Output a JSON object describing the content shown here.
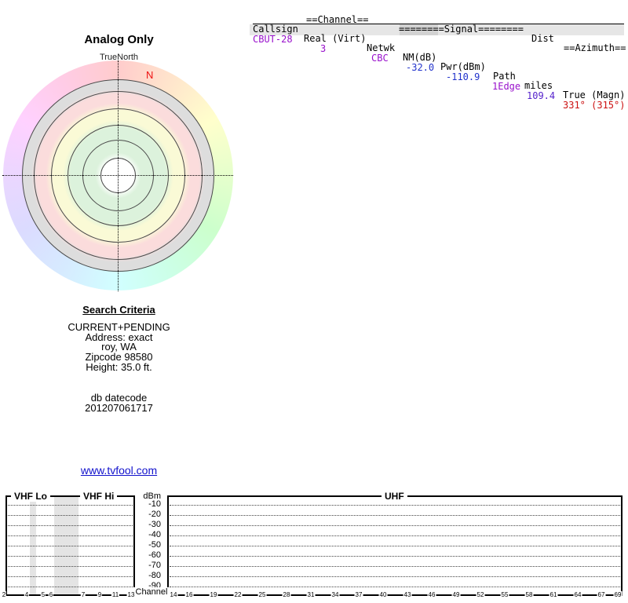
{
  "station_table": {
    "group_headers": {
      "channel": "==Channel==",
      "signal": "========Signal========",
      "dist": "Dist",
      "azimuth": "==Azimuth=="
    },
    "columns": {
      "callsign": "Callsign",
      "real_virt": "Real (Virt)",
      "netwk": "Netwk",
      "nm_db": "NM(dB)",
      "pwr_dbm": "Pwr(dBm)",
      "path": "Path",
      "miles": "miles",
      "true_magn": "True (Magn)"
    },
    "row": {
      "callsign": "CBUT-28",
      "real_channel": "3",
      "netwk": "CBC",
      "nm_db": "-32.0",
      "pwr_dbm": "-110.9",
      "path": "1Edge",
      "miles": "109.4",
      "azimuth": "331° (315°)"
    }
  },
  "radar": {
    "title": "Analog Only",
    "north_label": "TrueNorth",
    "north_marker": "N"
  },
  "search_criteria": {
    "title": "Search Criteria",
    "lines": [
      "CURRENT+PENDING",
      "Address: exact",
      "roy, WA",
      "Zipcode 98580",
      "Height: 35.0 ft."
    ],
    "db_label": "db datecode",
    "db_datecode": "201207061717"
  },
  "link": {
    "text": "www.tvfool.com"
  },
  "spectrum": {
    "vhf_lo": "VHF Lo",
    "vhf_hi": "VHF Hi",
    "uhf": "UHF",
    "y_axis": "dBm",
    "x_axis": "Channel",
    "y_ticks": [
      "-10",
      "-20",
      "-30",
      "-40",
      "-50",
      "-60",
      "-70",
      "-80",
      "-90"
    ],
    "vhf_channels": [
      "2",
      "4",
      "5",
      "6",
      "7",
      "9",
      "11",
      "13"
    ],
    "uhf_channels": [
      "14",
      "16",
      "19",
      "22",
      "25",
      "28",
      "31",
      "34",
      "37",
      "40",
      "43",
      "46",
      "49",
      "52",
      "55",
      "58",
      "61",
      "64",
      "67",
      "69"
    ]
  },
  "colors": {
    "callsign_purple": "#9911cc",
    "signal_blue": "#2233cc",
    "distance_blue": "#5522cc",
    "azimuth_red": "#cc1111",
    "link_blue": "#1111cc",
    "row_bg_gray": "#e6e6e6",
    "nm_highlight_gray": "#d2d2d2",
    "spectrum_band_gray": "#e4e4e4",
    "radar_green": "#dcf2dc",
    "radar_yellow": "#fafad6",
    "radar_pink": "#fbdcdc",
    "radar_gray": "#dddddd"
  },
  "chart_data": [
    {
      "type": "table",
      "title": "Station list",
      "columns": [
        "Callsign",
        "Channel Real (Virt)",
        "Netwk",
        "Signal NM(dB)",
        "Signal Pwr(dBm)",
        "Signal Path",
        "Dist miles",
        "Azimuth True (Magn)"
      ],
      "rows": [
        [
          "CBUT-28",
          "3",
          "CBC",
          "-32.0",
          "-110.9",
          "1Edge",
          "109.4",
          "331° (315°)"
        ]
      ]
    },
    {
      "type": "polar",
      "title": "Analog Only",
      "orientation": "TrueNorth up, N marker at top",
      "rings": "white center, two green bands, yellow band, pink band, gray band, outer pastel compass-hue ring (red at N, yellow-green at E, cyan at S, violet at W)",
      "stations_plotted": []
    },
    {
      "type": "bar",
      "title": "Channel signal levels (VHF Lo / VHF Hi / UHF)",
      "xlabel": "Channel",
      "ylabel": "dBm",
      "ylim": [
        -90,
        -10
      ],
      "grid": "dotted horizontal lines every 10 dBm",
      "categories": [
        "2",
        "4",
        "5",
        "6",
        "7",
        "9",
        "11",
        "13",
        "14",
        "16",
        "19",
        "22",
        "25",
        "28",
        "31",
        "34",
        "37",
        "40",
        "43",
        "46",
        "49",
        "52",
        "55",
        "58",
        "61",
        "64",
        "67",
        "69"
      ],
      "values": [],
      "note": "no station bars visible (all below -90 dBm); gray vertical stripes between channels 4-5 and 6-7 mark non-TV frequency gaps"
    }
  ]
}
